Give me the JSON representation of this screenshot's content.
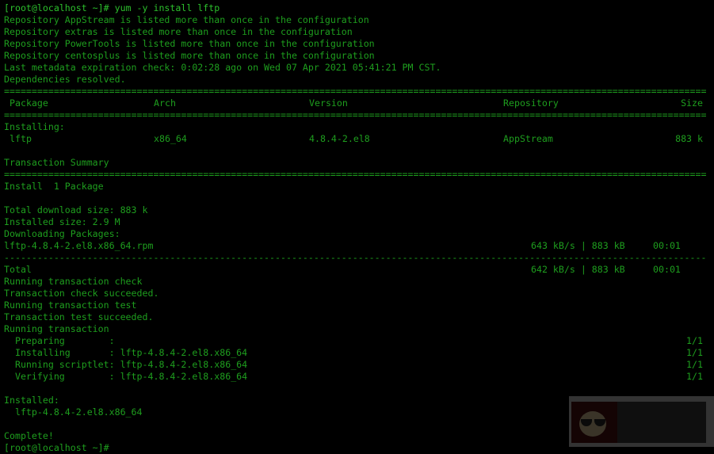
{
  "terminal": {
    "prompt": "[root@localhost ~]# yum -y install lftp",
    "repo_warnings": [
      "Repository AppStream is listed more than once in the configuration",
      "Repository extras is listed more than once in the configuration",
      "Repository PowerTools is listed more than once in the configuration",
      "Repository centosplus is listed more than once in the configuration"
    ],
    "metadata": "Last metadata expiration check: 0:02:28 ago on Wed 07 Apr 2021 05:41:21 PM CST.",
    "deps": "Dependencies resolved.",
    "table": {
      "headers": {
        "package": "Package",
        "arch": "Arch",
        "version": "Version",
        "repository": "Repository",
        "size": "Size"
      },
      "section": "Installing:",
      "row": {
        "package": "lftp",
        "arch": "x86_64",
        "version": "4.8.4-2.el8",
        "repository": "AppStream",
        "size": "883 k"
      }
    },
    "summary_title": "Transaction Summary",
    "install_count": "Install  1 Package",
    "download_size": "Total download size: 883 k",
    "installed_size": "Installed size: 2.9 M",
    "downloading": "Downloading Packages:",
    "rpm": {
      "name": "lftp-4.8.4-2.el8.x86_64.rpm",
      "speed": "643 kB/s | 883 kB",
      "time": "00:01"
    },
    "total": {
      "label": "Total",
      "speed": "642 kB/s | 883 kB",
      "time": "00:01"
    },
    "steps": [
      "Running transaction check",
      "Transaction check succeeded.",
      "Running transaction test",
      "Transaction test succeeded.",
      "Running transaction"
    ],
    "scriptlets": [
      {
        "label": "  Preparing        :",
        "pkg": "",
        "progress": "1/1"
      },
      {
        "label": "  Installing       :",
        "pkg": " lftp-4.8.4-2.el8.x86_64",
        "progress": "1/1"
      },
      {
        "label": "  Running scriptlet:",
        "pkg": " lftp-4.8.4-2.el8.x86_64",
        "progress": "1/1"
      },
      {
        "label": "  Verifying        :",
        "pkg": " lftp-4.8.4-2.el8.x86_64",
        "progress": "1/1"
      }
    ],
    "installed_title": "Installed:",
    "installed_pkg": "  lftp-4.8.4-2.el8.x86_64",
    "complete": "Complete!",
    "final_prompt": "[root@localhost ~]# "
  }
}
